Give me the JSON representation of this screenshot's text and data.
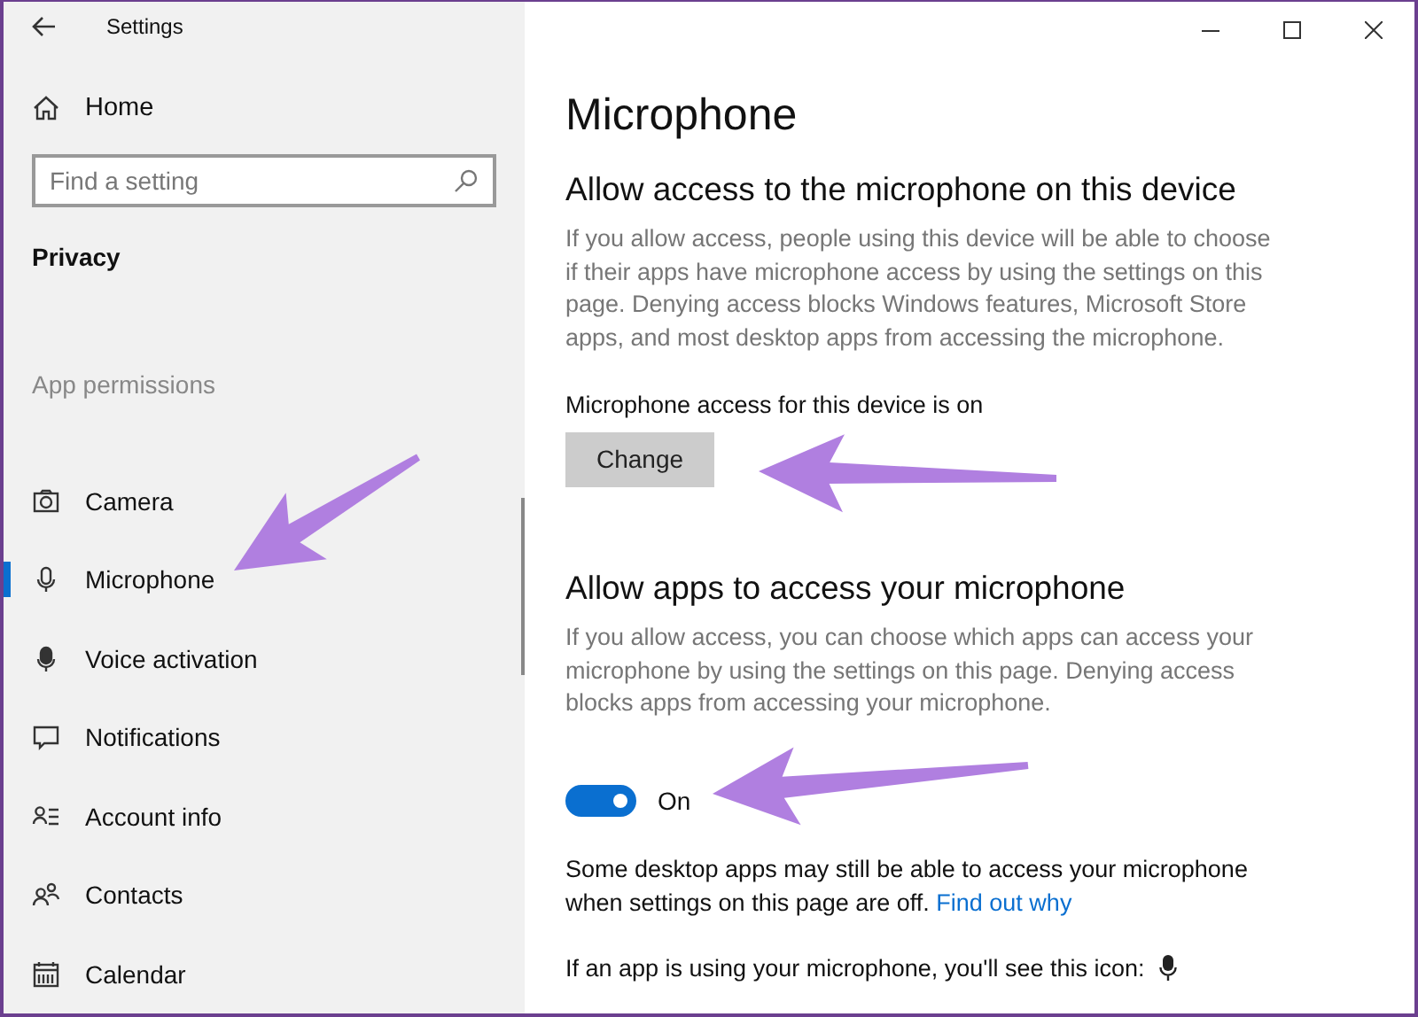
{
  "window": {
    "title": "Settings"
  },
  "sidebar": {
    "home": "Home",
    "search": {
      "placeholder": "Find a setting"
    },
    "section": "Privacy",
    "group": "App permissions",
    "items": [
      {
        "kind": "camera",
        "label": "Camera",
        "selected": false
      },
      {
        "kind": "microphone",
        "label": "Microphone",
        "selected": true
      },
      {
        "kind": "voice",
        "label": "Voice activation",
        "selected": false
      },
      {
        "kind": "notifications",
        "label": "Notifications",
        "selected": false
      },
      {
        "kind": "account",
        "label": "Account info",
        "selected": false
      },
      {
        "kind": "contacts",
        "label": "Contacts",
        "selected": false
      },
      {
        "kind": "calendar",
        "label": "Calendar",
        "selected": false
      }
    ]
  },
  "page": {
    "title": "Microphone",
    "device_section": {
      "heading": "Allow access to the microphone on this device",
      "description": "If you allow access, people using this device will be able to choose if their apps have microphone access by using the settings on this page. Denying access blocks Windows features, Microsoft Store apps, and most desktop apps from accessing the microphone.",
      "status": "Microphone access for this device is on",
      "button": "Change"
    },
    "apps_section": {
      "heading": "Allow apps to access your microphone",
      "description": "If you allow access, you can choose which apps can access your microphone by using the settings on this page. Denying access blocks apps from accessing your microphone.",
      "toggle": {
        "on": true,
        "label": "On"
      },
      "note": "Some desktop apps may still be able to access your microphone when settings on this page are off.",
      "link": "Find out why",
      "icon_note": "If an app is using your microphone, you'll see this icon:"
    }
  }
}
